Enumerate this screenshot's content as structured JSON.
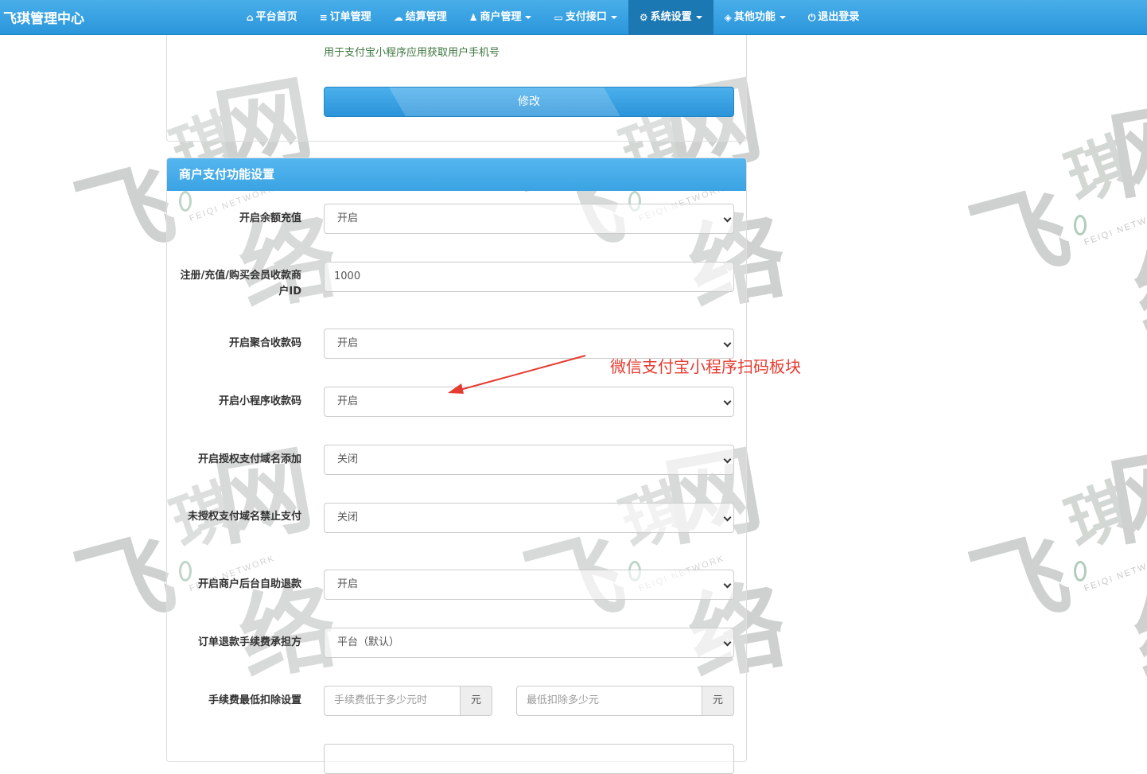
{
  "navbar": {
    "brand": "飞琪管理中心",
    "items": [
      {
        "icon": "home-icon",
        "glyph": "⌂",
        "label": "平台首页"
      },
      {
        "icon": "list-icon",
        "glyph": "≡",
        "label": "订单管理"
      },
      {
        "icon": "cloud-icon",
        "glyph": "☁",
        "label": "结算管理"
      },
      {
        "icon": "user-icon",
        "glyph": "♟",
        "label": "商户管理"
      },
      {
        "icon": "credit-card-icon",
        "glyph": "▭",
        "label": "支付接口"
      },
      {
        "icon": "gear-icon",
        "glyph": "⚙",
        "label": "系统设置"
      },
      {
        "icon": "cube-icon",
        "glyph": "◈",
        "label": "其他功能"
      },
      {
        "icon": "power-icon",
        "glyph": "⏻",
        "label": "退出登录"
      }
    ]
  },
  "top_panel": {
    "help_text": "用于支付宝小程序应用获取用户手机号",
    "submit_label": "修改"
  },
  "merchant_panel": {
    "title": "商户支付功能设置",
    "fields": {
      "balance_recharge": {
        "label": "开启余额充值",
        "value": "开启"
      },
      "member_merchant_id": {
        "label": "注册/充值/购买会员收款商户ID",
        "value": "1000"
      },
      "aggregate_qr": {
        "label": "开启聚合收款码",
        "value": "开启"
      },
      "miniprogram_qr": {
        "label": "开启小程序收款码",
        "value": "开启"
      },
      "auth_domain_add": {
        "label": "开启授权支付域名添加",
        "value": "关闭"
      },
      "unauth_domain_block": {
        "label": "未授权支付域名禁止支付",
        "value": "关闭"
      },
      "self_refund": {
        "label": "开启商户后台自助退款",
        "value": "开启"
      },
      "refund_fee_bearer": {
        "label": "订单退款手续费承担方",
        "value": "平台（默认）"
      },
      "min_fee": {
        "label": "手续费最低扣除设置",
        "threshold_placeholder": "手续费低于多少元时",
        "min_placeholder": "最低扣除多少元",
        "unit": "元"
      }
    }
  },
  "annotation": {
    "text": "微信支付宝小程序扫码板块",
    "color": "#e53b30"
  },
  "watermark": {
    "chars": [
      "飞",
      "琪",
      "网络"
    ],
    "subtitle": "FEIQI NETWORK"
  }
}
